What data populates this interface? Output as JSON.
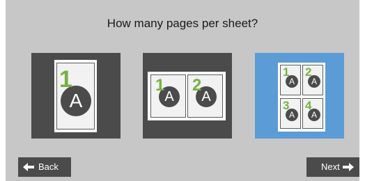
{
  "prompt": "How many pages per sheet?",
  "options": [
    {
      "pages_per_sheet": 1,
      "selected": false,
      "page_letter": "A",
      "page_numbers": [
        "1"
      ]
    },
    {
      "pages_per_sheet": 2,
      "selected": false,
      "page_letter": "A",
      "page_numbers": [
        "1",
        "2"
      ]
    },
    {
      "pages_per_sheet": 4,
      "selected": true,
      "page_letter": "A",
      "page_numbers": [
        "1",
        "2",
        "3",
        "4"
      ]
    }
  ],
  "nav": {
    "back_label": "Back",
    "back_icon": "arrow-left-icon",
    "next_label": "Next",
    "next_icon": "arrow-right-icon"
  },
  "colors": {
    "panel_bg": "#c7c7c7",
    "option_bg": "#4b4b4b",
    "option_selected_bg": "#5b9bd6",
    "page_number": "#76b043",
    "button_bg": "#4b4b4b"
  }
}
